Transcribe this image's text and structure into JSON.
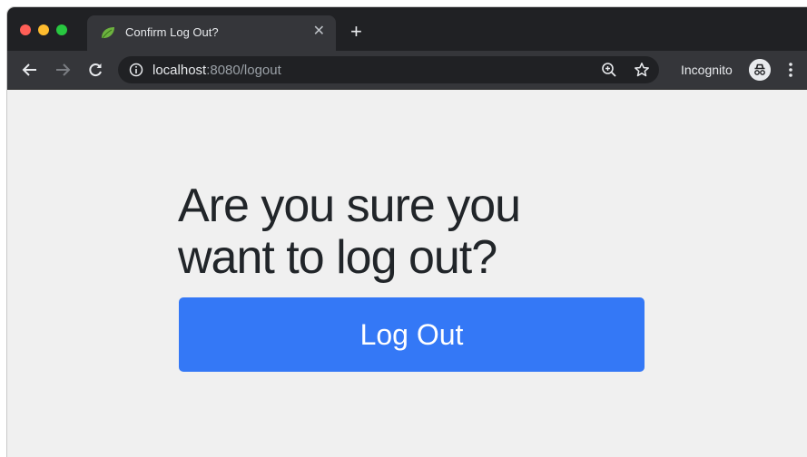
{
  "browser": {
    "tab": {
      "title": "Confirm Log Out?",
      "close_glyph": "✕",
      "favicon": "spring-leaf-icon"
    },
    "new_tab_glyph": "+",
    "address_bar": {
      "host": "localhost",
      "rest": ":8080/logout"
    },
    "incognito_label": "Incognito",
    "colors": {
      "frame": "#202124",
      "toolbar": "#35363a",
      "close": "#ff5f57",
      "minimize": "#febc2e",
      "zoom": "#28c840"
    }
  },
  "page": {
    "heading": "Are you sure you want to log out?",
    "button_label": "Log Out",
    "colors": {
      "background": "#f0f0f0",
      "button": "#3478f6",
      "text": "#212529"
    }
  }
}
